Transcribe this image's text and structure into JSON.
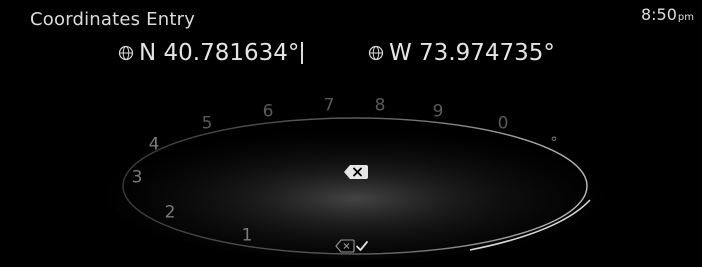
{
  "header": {
    "title": "Coordinates Entry",
    "time": "8:50",
    "ampm": "pm"
  },
  "coordinates": {
    "latitude": {
      "icon": "globe-icon",
      "value": "N 40.781634°"
    },
    "longitude": {
      "icon": "globe-icon",
      "value": "W 73.974735°"
    }
  },
  "dial": {
    "keys": [
      "1",
      "2",
      "3",
      "4",
      "5",
      "6",
      "7",
      "8",
      "9",
      "0",
      "°"
    ],
    "backspace_icon": "backspace-icon",
    "confirm_icon": "checkmark-icon"
  },
  "colors": {
    "background": "#000000",
    "text": "#dcdcdc",
    "dial_key": "#7c7c7c"
  }
}
